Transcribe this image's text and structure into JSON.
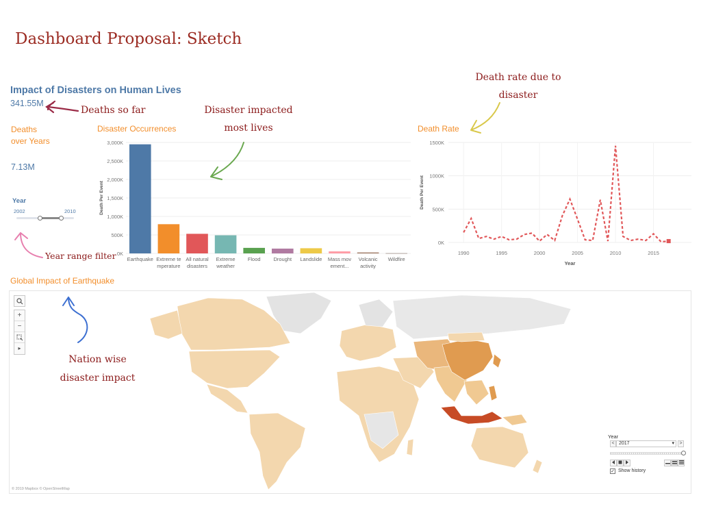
{
  "sketch_title": "Dashboard Proposal: Sketch",
  "viz_title": "Impact of Disasters on Human Lives",
  "total_deaths": "341.55M",
  "deaths_over_years": {
    "label": "Deaths over Years",
    "value": "7.13M"
  },
  "year_filter": {
    "label": "Year",
    "min": "2002",
    "max": "2010"
  },
  "annotations": {
    "deaths_so_far": "Deaths so far",
    "disaster_impacted": "Disaster impacted most lives",
    "death_rate_due": "Death rate due to disaster",
    "year_range_filter": "Year range filter",
    "nation_wise": "Nation wise disaster impact"
  },
  "colors": {
    "title_blue": "#4e79a7",
    "section_orange": "#f28e2b",
    "annotation_red": "#8b1a1a",
    "death_rate_line": "#e15759"
  },
  "chart_data": [
    {
      "type": "bar",
      "title": "Disaster Occurrences",
      "ylabel": "Death Per Event",
      "xlabel": "",
      "ylim": [
        0,
        3000000
      ],
      "yticks": [
        "0K",
        "500K",
        "1,000K",
        "1,500K",
        "2,000K",
        "2,500K",
        "3,000K"
      ],
      "grid": true,
      "categories": [
        "Earthquake",
        "Extreme te mperature",
        "All natural disasters",
        "Extreme weather",
        "Flood",
        "Drought",
        "Landslide",
        "Mass mov ement...",
        "Volcanic activity",
        "Wildfire"
      ],
      "values": [
        2950000,
        790000,
        530000,
        490000,
        150000,
        130000,
        140000,
        55000,
        25000,
        10000
      ],
      "colors": [
        "#4e79a7",
        "#f28e2b",
        "#e15759",
        "#76b7b2",
        "#59a14f",
        "#b07aa1",
        "#edc948",
        "#ff9da7",
        "#9c755f",
        "#bab0ac"
      ]
    },
    {
      "type": "line",
      "title": "Death Rate",
      "xlabel": "Year",
      "ylabel": "Death Per Event",
      "xlim": [
        1988,
        2020
      ],
      "ylim": [
        0,
        1500000
      ],
      "xticks": [
        "1990",
        "1995",
        "2000",
        "2005",
        "2010",
        "2015"
      ],
      "yticks": [
        "0K",
        "500K",
        "1000K",
        "1500K"
      ],
      "grid": true,
      "line_style": "dashed",
      "series": [
        {
          "x": [
            1990,
            1991,
            1992,
            1993,
            1994,
            1995,
            1996,
            1997,
            1998,
            1999,
            2000,
            2001,
            2002,
            2003,
            2004,
            2005,
            2006,
            2007,
            2008,
            2009,
            2010,
            2011,
            2012,
            2013,
            2014,
            2015,
            2016,
            2017
          ],
          "y": [
            150000,
            360000,
            60000,
            90000,
            50000,
            90000,
            40000,
            50000,
            120000,
            140000,
            20000,
            120000,
            30000,
            400000,
            650000,
            350000,
            40000,
            30000,
            640000,
            20000,
            1450000,
            90000,
            30000,
            50000,
            30000,
            130000,
            10000,
            20000
          ]
        }
      ]
    }
  ],
  "map": {
    "title": "Global Impact of Earthquake",
    "credit": "© 2019 Mapbox © OpenStreetMap",
    "controls": {
      "search_icon": "magnifier-icon",
      "zoom_in": "+",
      "zoom_out": "−",
      "select_icon": "lasso-icon",
      "expand": "▸"
    }
  },
  "time_control": {
    "label": "Year",
    "selected": "2017",
    "prev": "<",
    "next": ">",
    "dropdown": "▾",
    "show_history": "Show history",
    "show_history_checked": true
  }
}
